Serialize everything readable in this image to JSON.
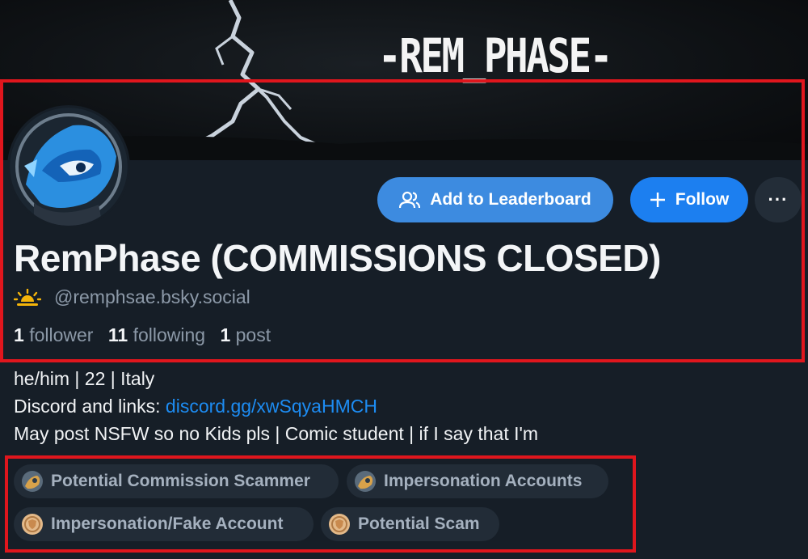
{
  "banner": {
    "title": "-REM_PHASE-"
  },
  "profile": {
    "display_name": "RemPhase (COMMISSIONS CLOSED)",
    "handle": "@remphsae.bsky.social",
    "stats": {
      "followers_count": "1",
      "followers_label": "follower",
      "following_count": "11",
      "following_label": "following",
      "posts_count": "1",
      "posts_label": "post"
    },
    "bio": {
      "line1": "he/him | 22 | Italy",
      "line2_prefix": "Discord and links: ",
      "line2_link": "discord.gg/xwSqyaHMCH",
      "line3": "May post NSFW so no Kids pls | Comic student | if I say that I'm"
    }
  },
  "actions": {
    "leaderboard_label": "Add to Leaderboard",
    "follow_label": "Follow",
    "more_label": "···"
  },
  "labels": [
    {
      "text": "Potential Commission Scammer",
      "icon": "moderator-avatar-icon"
    },
    {
      "text": "Impersonation Accounts",
      "icon": "moderator-avatar-icon"
    },
    {
      "text": "Impersonation/Fake Account",
      "icon": "shield-badge-icon"
    },
    {
      "text": "Potential Scam",
      "icon": "shield-badge-icon"
    }
  ],
  "colors": {
    "background": "#161e27",
    "accent": "#1c7ff0",
    "secondary_button": "#3d8be0",
    "link": "#1d8cf2",
    "highlight_box": "#e0161d",
    "muted_text": "#8c99a8"
  }
}
